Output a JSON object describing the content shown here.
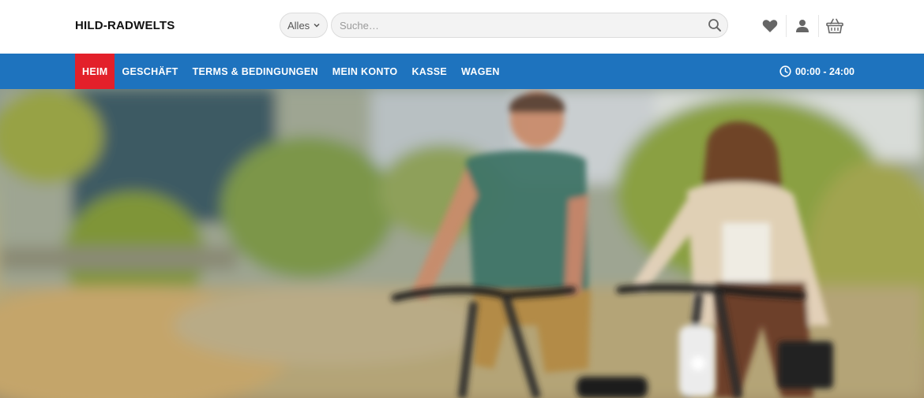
{
  "site": {
    "logo": "HILD-RADWELTS"
  },
  "search": {
    "category": "Alles",
    "placeholder": "Suche…"
  },
  "header_icons": [
    "heart-icon",
    "user-icon",
    "basket-icon"
  ],
  "nav": {
    "items": [
      {
        "label": "HEIM",
        "active": true
      },
      {
        "label": "GESCHÄFT",
        "active": false
      },
      {
        "label": "TERMS & BEDINGUNGEN",
        "active": false
      },
      {
        "label": "MEIN KONTO",
        "active": false
      },
      {
        "label": "KASSE",
        "active": false
      },
      {
        "label": "WAGEN",
        "active": false
      }
    ],
    "hours": "00:00 - 24:00"
  },
  "colors": {
    "nav_bg": "#1e73be",
    "active_bg": "#e3202a",
    "text": "#111111"
  },
  "hero": {
    "image": "couple-riding-e-bikes-photo"
  }
}
